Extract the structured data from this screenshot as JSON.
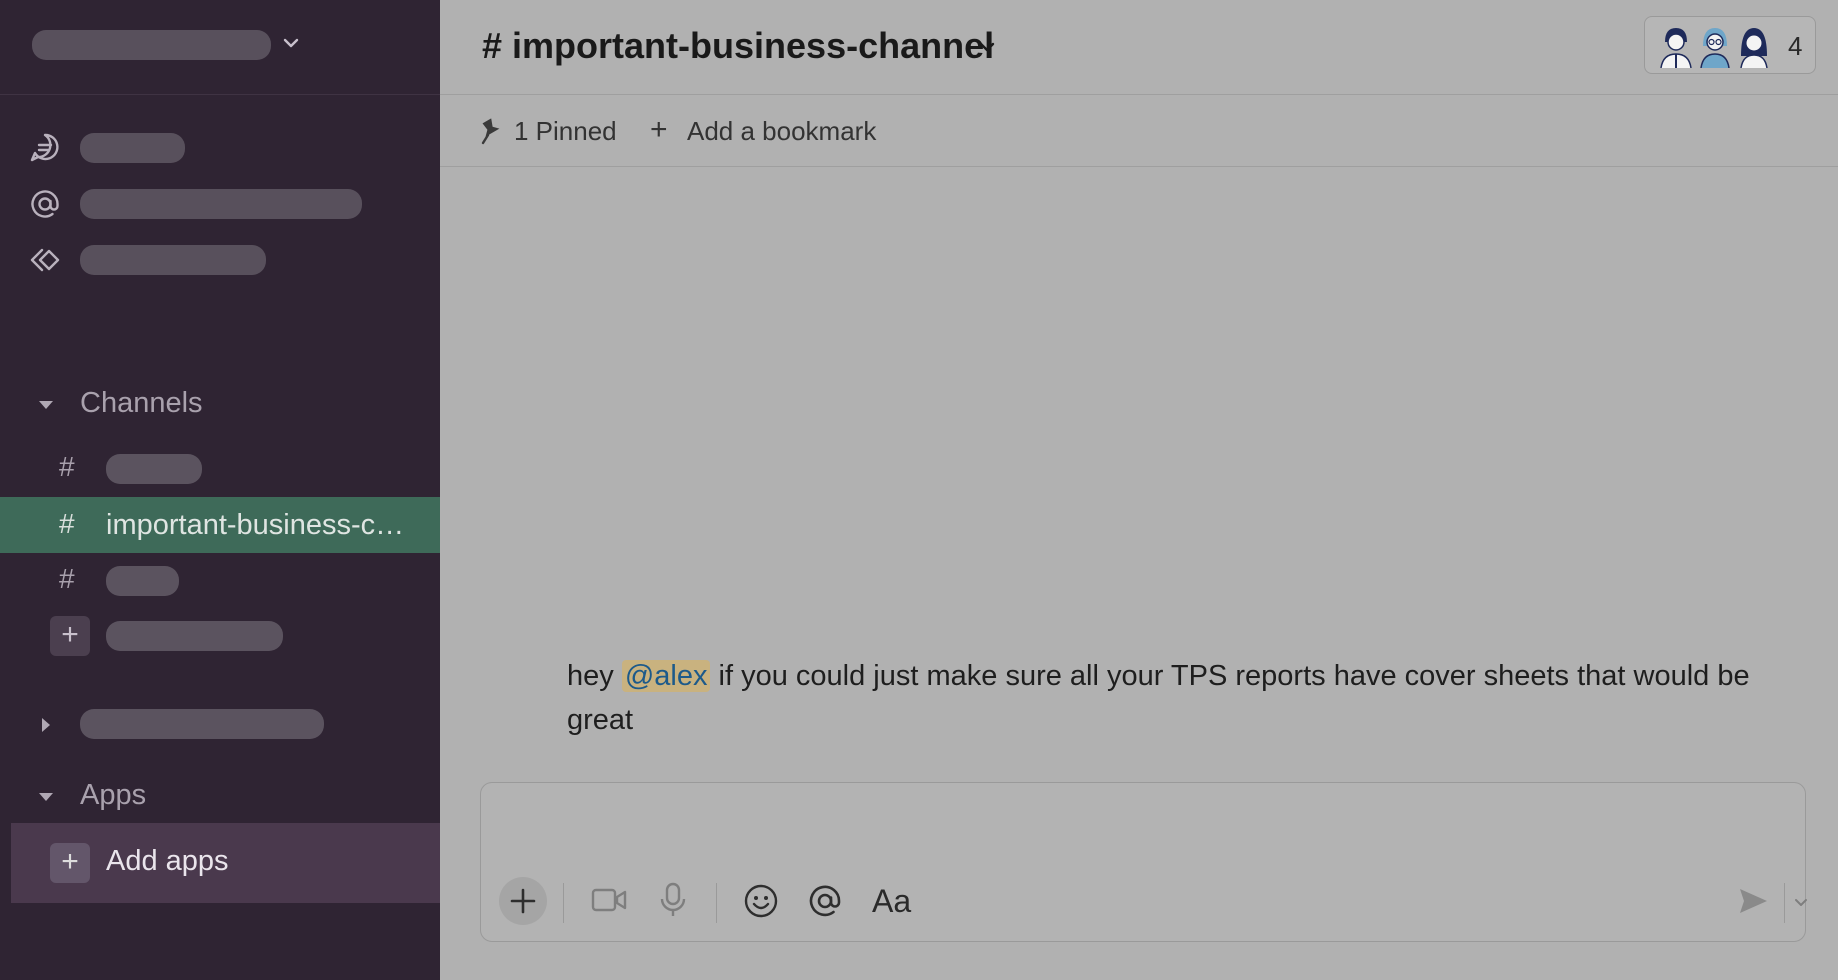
{
  "channel": {
    "name": "important-business-channel",
    "hash_symbol": "#",
    "member_count": "4"
  },
  "bookmarks": {
    "pinned_label": "1 Pinned",
    "add_bookmark_label": "Add a bookmark"
  },
  "sidebar": {
    "sections": {
      "channels_label": "Channels",
      "apps_label": "Apps"
    },
    "channels": [
      {
        "hash": "#",
        "label": ""
      },
      {
        "hash": "#",
        "label": "important-business-c…"
      },
      {
        "hash": "#",
        "label": ""
      }
    ],
    "add_apps_label": "Add apps"
  },
  "message": {
    "before_mention": "hey ",
    "mention": "@alex",
    "after_mention": " if you could just make sure all your TPS reports have cover sheets that would be great"
  },
  "composer": {
    "format_label": "Aa"
  },
  "icons": {
    "threads": "threads-icon",
    "mentions": "at-mentions-icon",
    "drafts": "drafts-icon",
    "pin": "pin-icon",
    "video": "video-icon",
    "mic": "microphone-icon",
    "emoji": "emoji-icon",
    "send": "send-icon"
  },
  "colors": {
    "sidebar_bg": "#2f2433",
    "active_channel_bg": "#3e6a59",
    "mention_bg": "#c9b27f",
    "mention_text": "#1d5a8a"
  }
}
